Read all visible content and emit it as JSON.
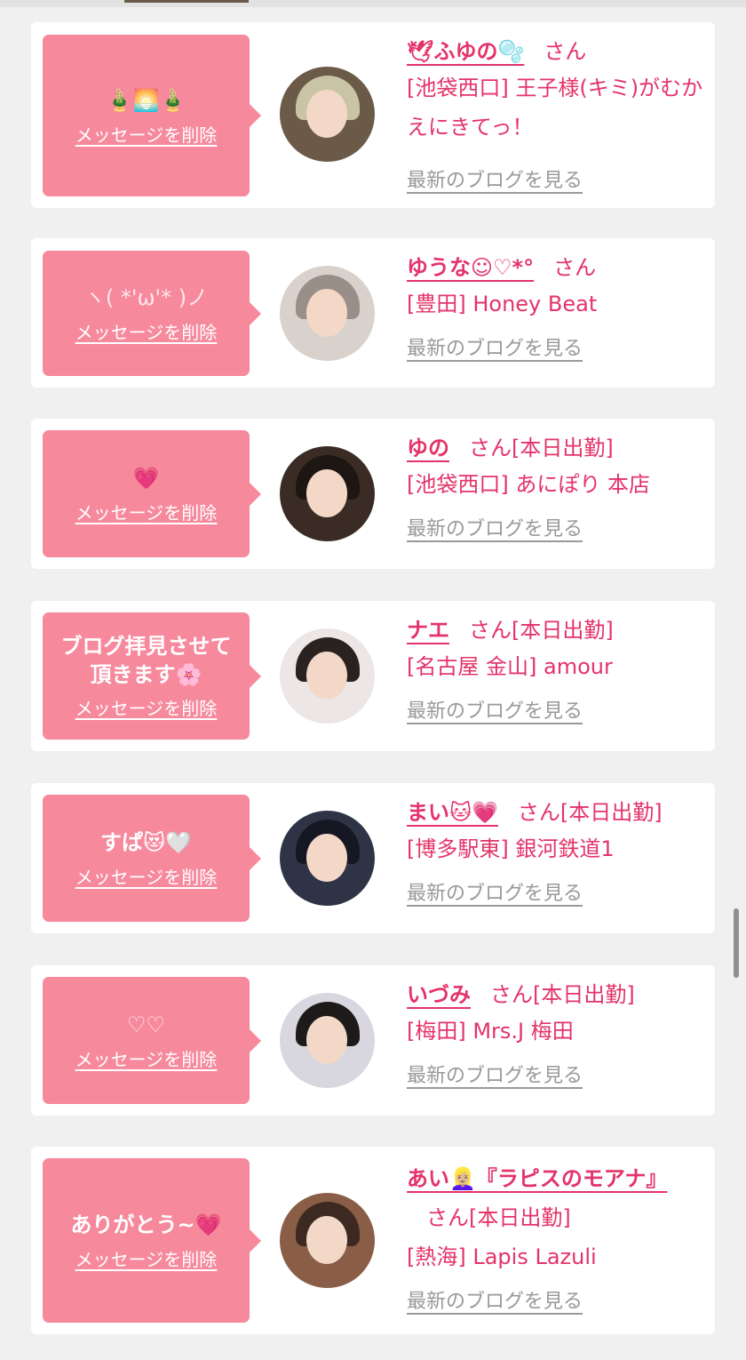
{
  "delete_label": "メッセージを削除",
  "blog_label": "最新のブログを見る",
  "honorific": "さん",
  "cards": [
    {
      "message": "🎍🌅🎍",
      "name": "🕊ふゆの🫧",
      "status": "",
      "shop": "[池袋西口] 王子様(キミ)がむかえにきてっ！"
    },
    {
      "message": "ヽ( *'ω'* )ノ",
      "name": "ゆうな☺︎♡*°",
      "status": "",
      "shop": "[豊田] Honey Beat"
    },
    {
      "message": "💗",
      "name": "ゆの",
      "status": "[本日出勤]",
      "shop": "[池袋西口] あにぽり 本店"
    },
    {
      "message": "ブログ拝見させて頂きます🌸",
      "name": "ナエ",
      "status": "[本日出勤]",
      "shop": "[名古屋 金山] amour"
    },
    {
      "message": "すぱ😻🤍",
      "name": "まい🐱💗",
      "status": "[本日出勤]",
      "shop": "[博多駅東] 銀河鉄道1"
    },
    {
      "message": "♡♡",
      "name": "いづみ",
      "status": "[本日出勤]",
      "shop": "[梅田] Mrs.J 梅田"
    },
    {
      "message": "ありがとう~💗",
      "name": "あい👱🏼‍♀️『ラピスのモアナ』",
      "status": "[本日出勤]",
      "shop": "[熱海] Lapis Lazuli"
    }
  ],
  "colors": {
    "accent": "#e4336a",
    "bubble": "#f7899d",
    "link_gray": "#999999"
  }
}
